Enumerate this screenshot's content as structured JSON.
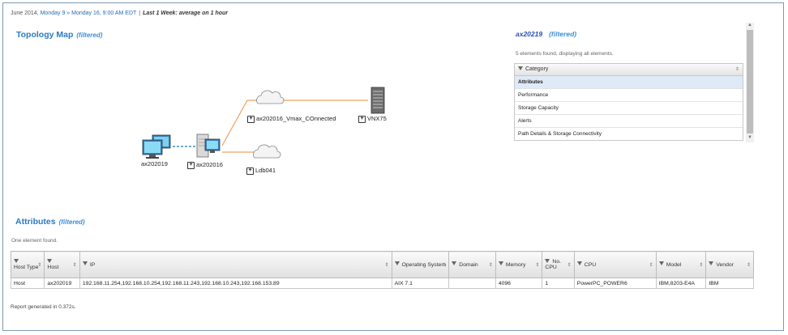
{
  "header": {
    "date_start": "June 2014, ",
    "date_range": "Monday 9 » Monday 16, 9:00 AM EDT",
    "separator": "|",
    "average": "Last 1 Week: average on 1 hour"
  },
  "topology": {
    "title": "Topology Map",
    "filter_tag": "(filtered)",
    "nodes": {
      "host": "ax202019",
      "server": "ax202016",
      "cloud_top": "ax202016_Vmax_COnnected",
      "storage": "VNX75",
      "cloud_bottom": "Ldb041"
    },
    "colors": {
      "link": "#f0a060",
      "dashed_link": "#3a8fb0"
    }
  },
  "details": {
    "title": "ax20219",
    "filter_tag": "(filtered)",
    "found_text": "5 elements found, displaying all elements.",
    "category_header": "Category",
    "categories": [
      "Attributes",
      "Performance",
      "Storage Capacity",
      "Alerts",
      "Path Details & Storage Connectivity"
    ]
  },
  "attributes": {
    "title": "Attributes",
    "filter_tag": "(filtered)",
    "found_text": "One element found.",
    "columns": [
      "Host Type",
      "Host",
      "IP",
      "Operating System",
      "Domain",
      "Memory",
      "No. CPU",
      "CPU",
      "Model",
      "Vendor"
    ],
    "rows": [
      [
        "Host",
        "ax202019",
        "192.168.11.254,192.168.10.254,192.168.11.243,192.168.10.243,192.168.153.89",
        "AIX 7.1",
        "",
        "4096",
        "1",
        "PowerPC_POWER6",
        "IBM,8203-E4A",
        "IBM"
      ]
    ]
  },
  "footer": {
    "report": "Report generated in 0.372s."
  }
}
